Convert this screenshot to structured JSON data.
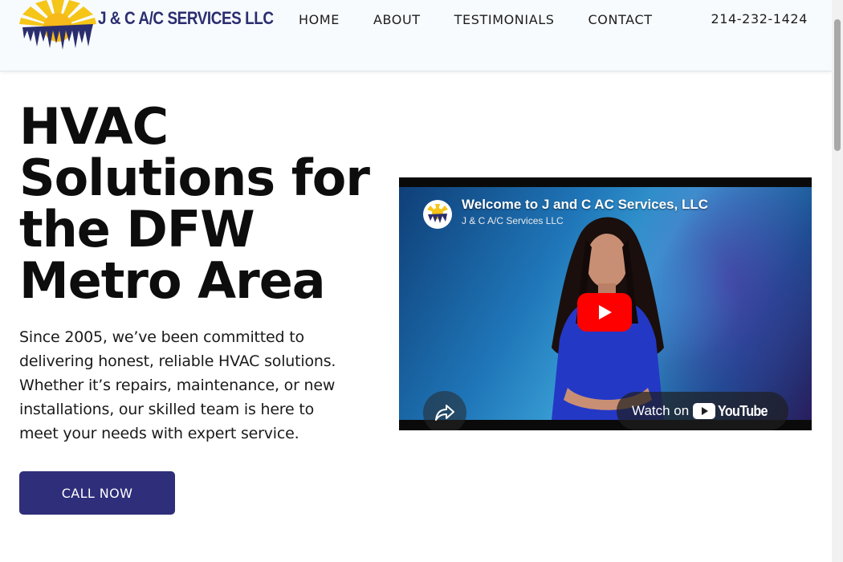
{
  "header": {
    "logo_text": "J & C A/C SERVICES LLC",
    "nav": [
      {
        "label": "HOME"
      },
      {
        "label": "ABOUT"
      },
      {
        "label": "TESTIMONIALS"
      },
      {
        "label": "CONTACT"
      }
    ],
    "phone": "214-232-1424"
  },
  "hero": {
    "title": "HVAC Solutions for the DFW Metro Area",
    "description": "Since 2005, we’ve been committed to delivering honest, reliable HVAC solutions. Whether it’s repairs, maintenance, or new installations, our skilled team is here to meet your needs with expert service.",
    "cta_label": "CALL NOW"
  },
  "video": {
    "title": "Welcome to J and C AC Services, LLC",
    "channel": "J & C A/C Services LLC",
    "watch_on_label": "Watch on",
    "youtube_label": "YouTube"
  },
  "colors": {
    "brand_navy": "#2e2e7a",
    "logo_text": "#2b2e6e",
    "sun_yellow": "#f5c518",
    "youtube_red": "#ff0000"
  },
  "icons": [
    "sun-logo-icon",
    "play-icon",
    "share-icon",
    "youtube-icon"
  ]
}
